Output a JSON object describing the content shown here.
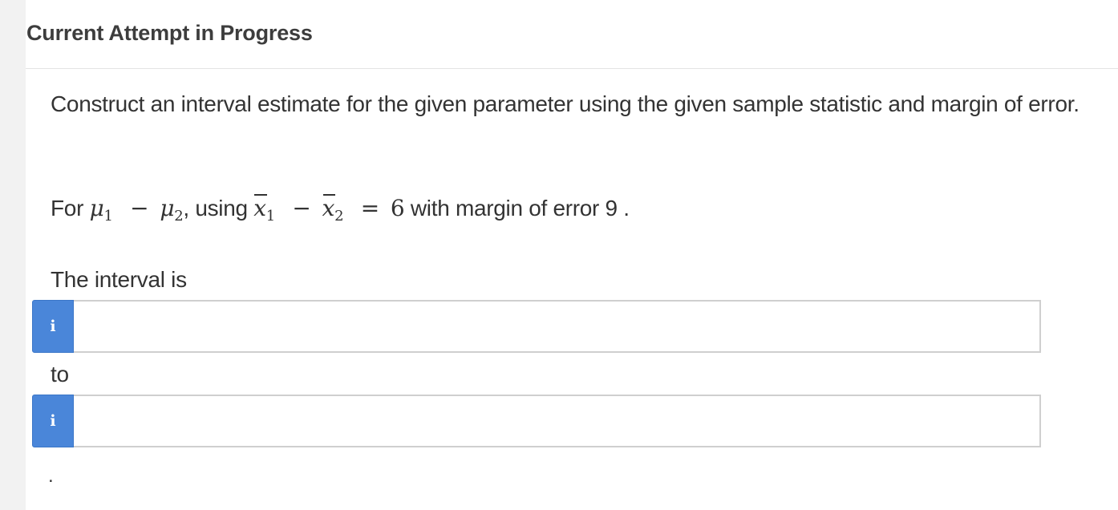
{
  "header": {
    "title": "Current Attempt in Progress"
  },
  "question": {
    "instruction": "Construct an interval estimate for the given parameter using the given sample statistic and margin of error.",
    "problem": {
      "prefix": "For",
      "mu": "μ",
      "sub1": "1",
      "minus": "−",
      "sub2": "2",
      "using_text": ", using",
      "xbar": "x",
      "equals": "=",
      "value": "6",
      "suffix": "with margin of error 9 ."
    },
    "interval_label": "The interval is",
    "to_label": "to",
    "trailing_period": "."
  },
  "answers": {
    "lower": {
      "info_label": "i",
      "value": ""
    },
    "upper": {
      "info_label": "i",
      "value": ""
    }
  },
  "colors": {
    "info_button": "#4a86d9",
    "page_background": "#f2f2f2",
    "panel_background": "#ffffff"
  }
}
